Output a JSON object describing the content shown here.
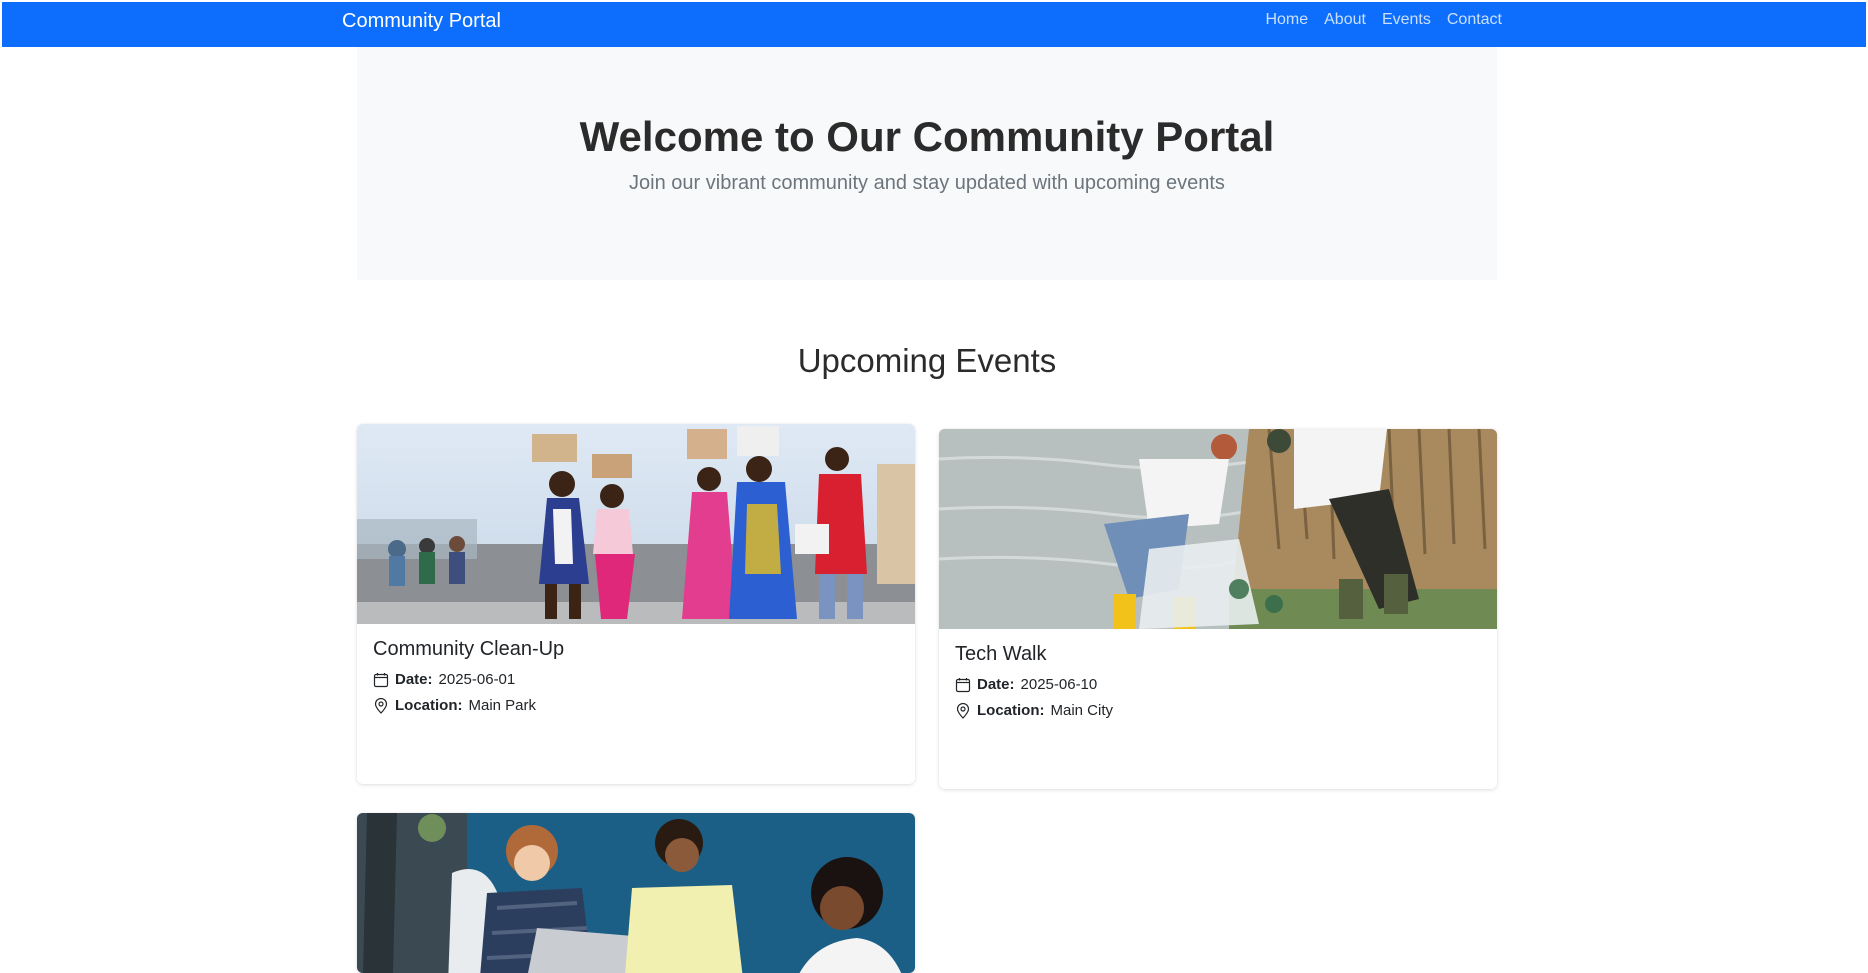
{
  "navbar": {
    "brand": "Community Portal",
    "links": [
      "Home",
      "About",
      "Events",
      "Contact"
    ],
    "color": "#0d6efd"
  },
  "hero": {
    "title": "Welcome to Our Community Portal",
    "subtitle": "Join our vibrant community and stay updated with upcoming events"
  },
  "events_section": {
    "title": "Upcoming Events",
    "date_label": "Date:",
    "location_label": "Location:",
    "events": [
      {
        "title": "Community Clean-Up",
        "date": "2025-06-01",
        "location": "Main Park",
        "image": "people-marching-carrying-boxes-photo"
      },
      {
        "title": "Tech Walk",
        "date": "2025-06-10",
        "location": "Main City",
        "image": "volunteers-collecting-trash-by-water-photo"
      },
      {
        "title": "",
        "date": "",
        "location": "",
        "image": "students-with-laptop-photo"
      }
    ]
  }
}
